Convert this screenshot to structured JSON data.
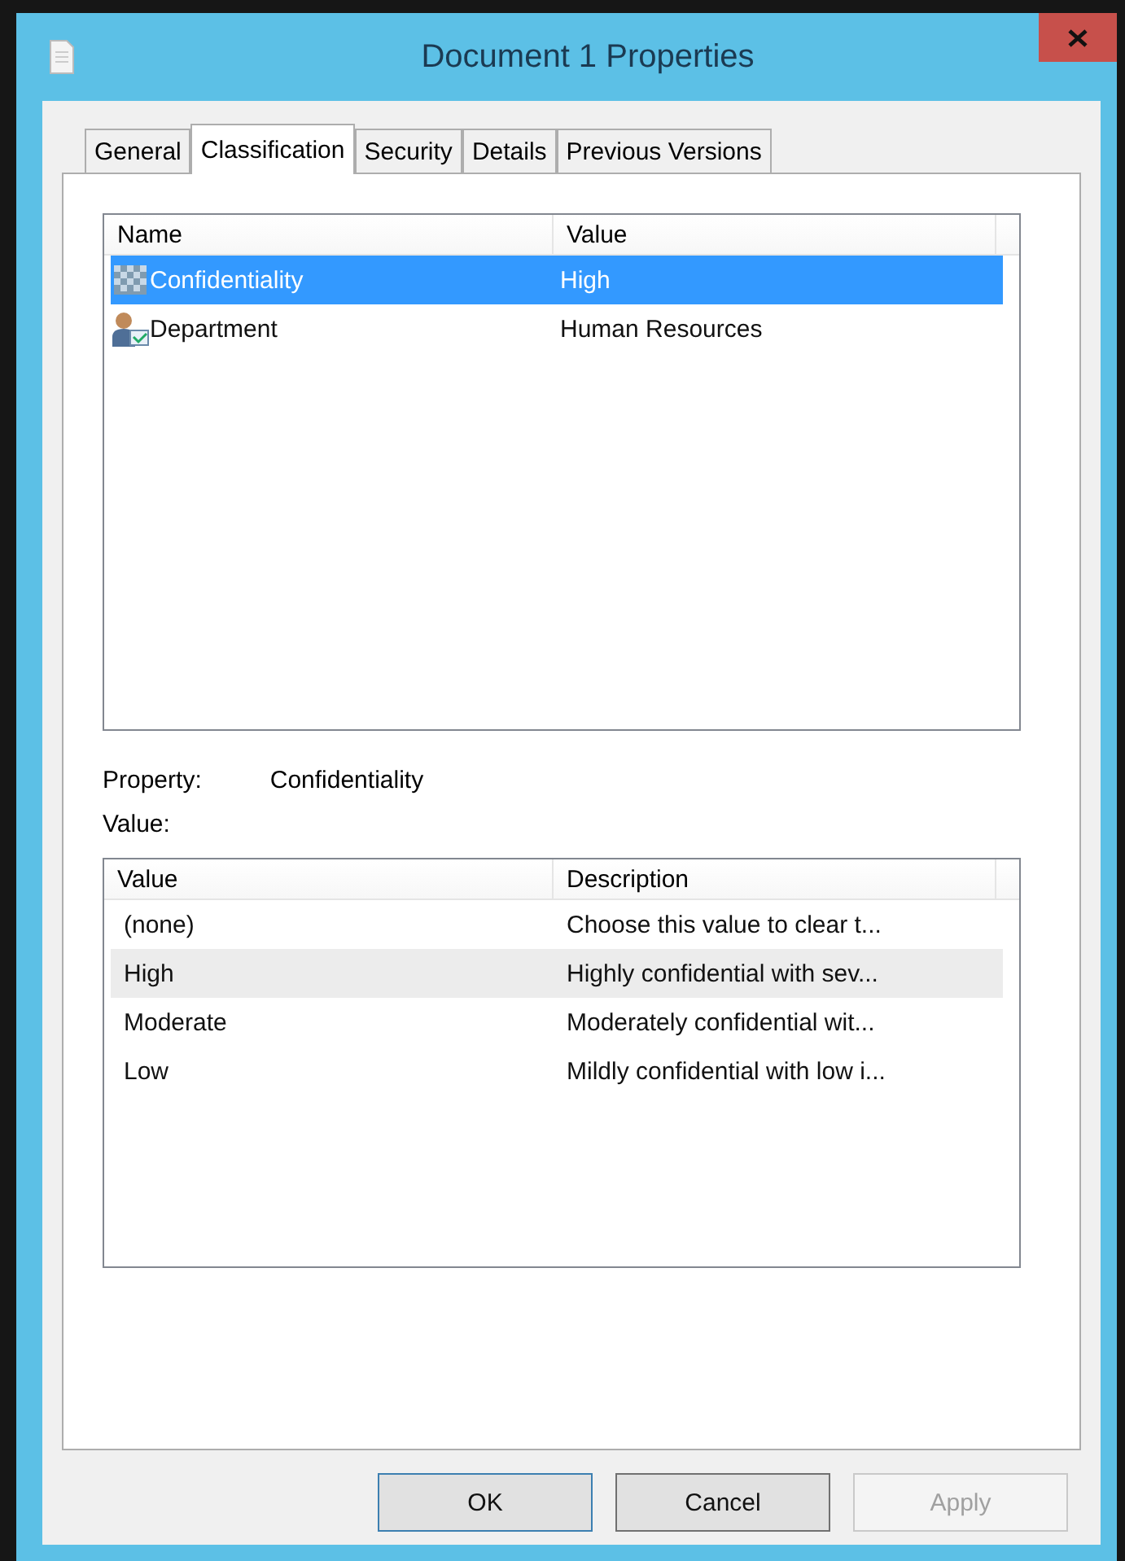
{
  "window": {
    "title": "Document 1 Properties"
  },
  "tabs": [
    {
      "label": "General",
      "selected": false
    },
    {
      "label": "Classification",
      "selected": true
    },
    {
      "label": "Security",
      "selected": false
    },
    {
      "label": "Details",
      "selected": false
    },
    {
      "label": "Previous Versions",
      "selected": false
    }
  ],
  "properties_list": {
    "columns": [
      "Name",
      "Value"
    ],
    "rows": [
      {
        "name": "Confidentiality",
        "value": "High",
        "kind": "choice",
        "selected": true
      },
      {
        "name": "Department",
        "value": "Human Resources",
        "kind": "directory",
        "selected": false
      }
    ]
  },
  "property": {
    "label": "Property:",
    "value": "Confidentiality"
  },
  "value_label": "Value:",
  "values_list": {
    "columns": [
      "Value",
      "Description"
    ],
    "rows": [
      {
        "value": "(none)",
        "description": "Choose this value to clear t...",
        "highlighted": false
      },
      {
        "value": "High",
        "description": "Highly confidential with sev...",
        "highlighted": true
      },
      {
        "value": "Moderate",
        "description": "Moderately confidential wit...",
        "highlighted": false
      },
      {
        "value": "Low",
        "description": "Mildly confidential with low i...",
        "highlighted": false
      }
    ]
  },
  "buttons": [
    {
      "label": "OK",
      "disabled": false
    },
    {
      "label": "Cancel",
      "disabled": false
    },
    {
      "label": "Apply",
      "disabled": true
    }
  ]
}
